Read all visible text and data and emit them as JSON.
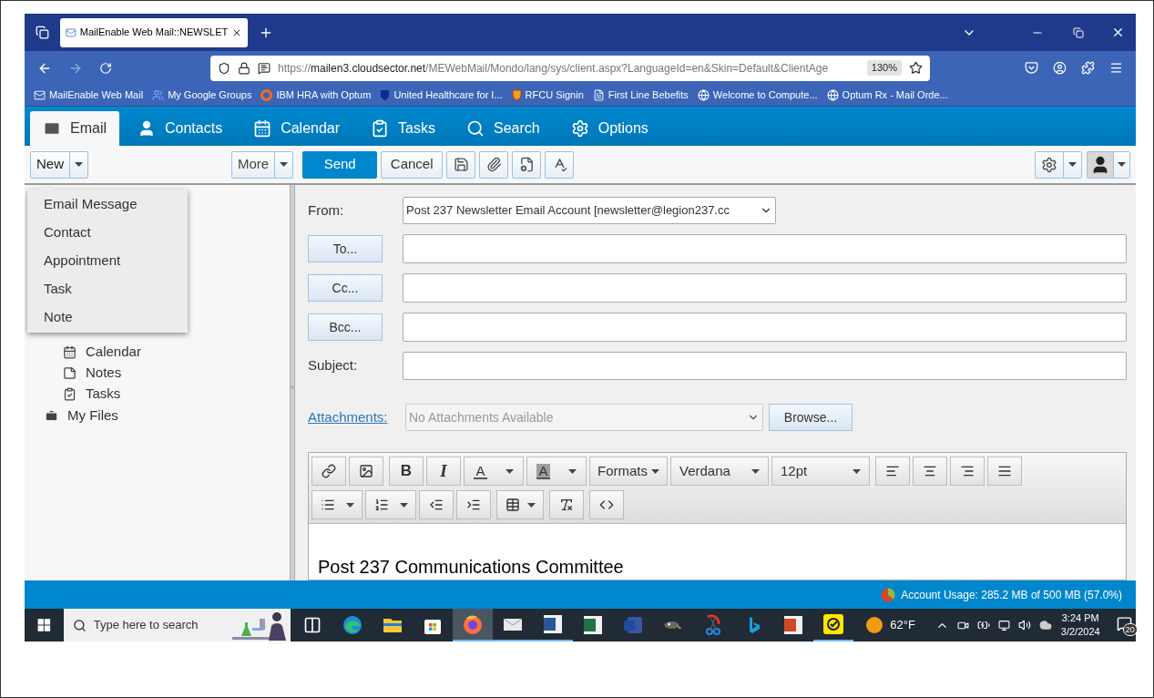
{
  "browser": {
    "tab": {
      "title": "MailEnable Web Mail::NEWSLET"
    },
    "url": {
      "scheme": "https://",
      "host": "mailen3.cloudsector.net",
      "path": "/MEWebMail/Mondo/lang/sys/client.aspx?LanguageId=en&Skin=Default&ClientAge"
    },
    "zoom": "130%",
    "bookmarks": [
      {
        "kind": "mail",
        "label": "MailEnable Web Mail"
      },
      {
        "kind": "people",
        "label": "My Google Groups"
      },
      {
        "kind": "ring",
        "label": "IBM HRA with Optum"
      },
      {
        "kind": "shield",
        "label": "United Healthcare for I..."
      },
      {
        "kind": "badge",
        "label": "RFCU Signin"
      },
      {
        "kind": "doc",
        "label": "First Line Bebefits"
      },
      {
        "kind": "globe",
        "label": "Welcome to Compute..."
      },
      {
        "kind": "globe",
        "label": "Optum Rx - Mail Orde..."
      }
    ]
  },
  "app_tabs": [
    {
      "kind": "email",
      "label": "Email",
      "selected": true
    },
    {
      "kind": "contacts",
      "label": "Contacts",
      "selected": false
    },
    {
      "kind": "calendar",
      "label": "Calendar",
      "selected": false
    },
    {
      "kind": "tasks",
      "label": "Tasks",
      "selected": false
    },
    {
      "kind": "search",
      "label": "Search",
      "selected": false
    },
    {
      "kind": "options",
      "label": "Options",
      "selected": false
    }
  ],
  "toolbar": {
    "new": "New",
    "more": "More",
    "send": "Send",
    "cancel": "Cancel"
  },
  "new_menu": {
    "expanded": true,
    "items": [
      "Email Message",
      "Contact",
      "Appointment",
      "Task",
      "Note"
    ]
  },
  "folders": {
    "children": [
      {
        "kind": "calendar",
        "label": "Calendar"
      },
      {
        "kind": "notes",
        "label": "Notes"
      },
      {
        "kind": "tasks",
        "label": "Tasks"
      }
    ],
    "root": [
      {
        "kind": "files",
        "label": "My Files"
      }
    ]
  },
  "compose": {
    "from_label": "From:",
    "from_value": "Post 237 Newsletter Email Account [newsletter@legion237.cc",
    "recipients": [
      {
        "button": "To..."
      },
      {
        "button": "Cc..."
      },
      {
        "button": "Bcc..."
      }
    ],
    "subject_label": "Subject:",
    "attachments_link": "Attachments:",
    "attachments_value": "No Attachments Available",
    "browse": "Browse...",
    "editor": {
      "rows": [
        [
          [
            {
              "kind": "link"
            },
            {
              "kind": "image"
            }
          ],
          [
            {
              "kind": "bold",
              "label": "B"
            },
            {
              "kind": "italic",
              "label": "I"
            },
            {
              "kind": "forecolor",
              "label": "A"
            },
            {
              "kind": "backcolor",
              "label": "A"
            },
            {
              "kind": "formats",
              "label": "Formats"
            },
            {
              "kind": "font",
              "label": "Verdana"
            },
            {
              "kind": "size",
              "label": "12pt"
            }
          ],
          [
            {
              "kind": "align-left"
            },
            {
              "kind": "align-center"
            },
            {
              "kind": "align-right"
            },
            {
              "kind": "justify"
            }
          ]
        ],
        [
          [
            {
              "kind": "bullets"
            },
            {
              "kind": "numbers"
            },
            {
              "kind": "outdent"
            },
            {
              "kind": "indent"
            }
          ],
          [
            {
              "kind": "table"
            }
          ],
          [
            {
              "kind": "clear"
            }
          ],
          [
            {
              "kind": "code"
            }
          ]
        ]
      ],
      "body": "Post 237 Communications Committee"
    }
  },
  "status_bar": {
    "usage": "Account Usage: 285.2 MB of 500 MB (57.0%)"
  },
  "taskbar": {
    "search_placeholder": "Type here to search",
    "apps": [
      {
        "kind": "taskview",
        "selected": false,
        "running": false
      },
      {
        "kind": "edge",
        "selected": false,
        "running": false
      },
      {
        "kind": "explorer",
        "selected": false,
        "running": false
      },
      {
        "kind": "store",
        "selected": false,
        "running": false
      },
      {
        "kind": "firefox",
        "selected": true,
        "running": true
      },
      {
        "kind": "mail",
        "selected": false,
        "running": true
      },
      {
        "kind": "word",
        "selected": false,
        "running": true
      },
      {
        "kind": "excel",
        "selected": false,
        "running": false
      },
      {
        "kind": "visio",
        "selected": false,
        "running": false
      },
      {
        "kind": "gimp",
        "selected": false,
        "running": false
      },
      {
        "kind": "snip",
        "selected": false,
        "running": false
      },
      {
        "kind": "bing",
        "selected": false,
        "running": false
      },
      {
        "kind": "powerpoint",
        "selected": false,
        "running": false
      },
      {
        "kind": "check",
        "selected": false,
        "running": true
      }
    ],
    "weather": "62°F",
    "time": "3:24 PM",
    "date": "3/2/2024",
    "notifications": "20"
  }
}
